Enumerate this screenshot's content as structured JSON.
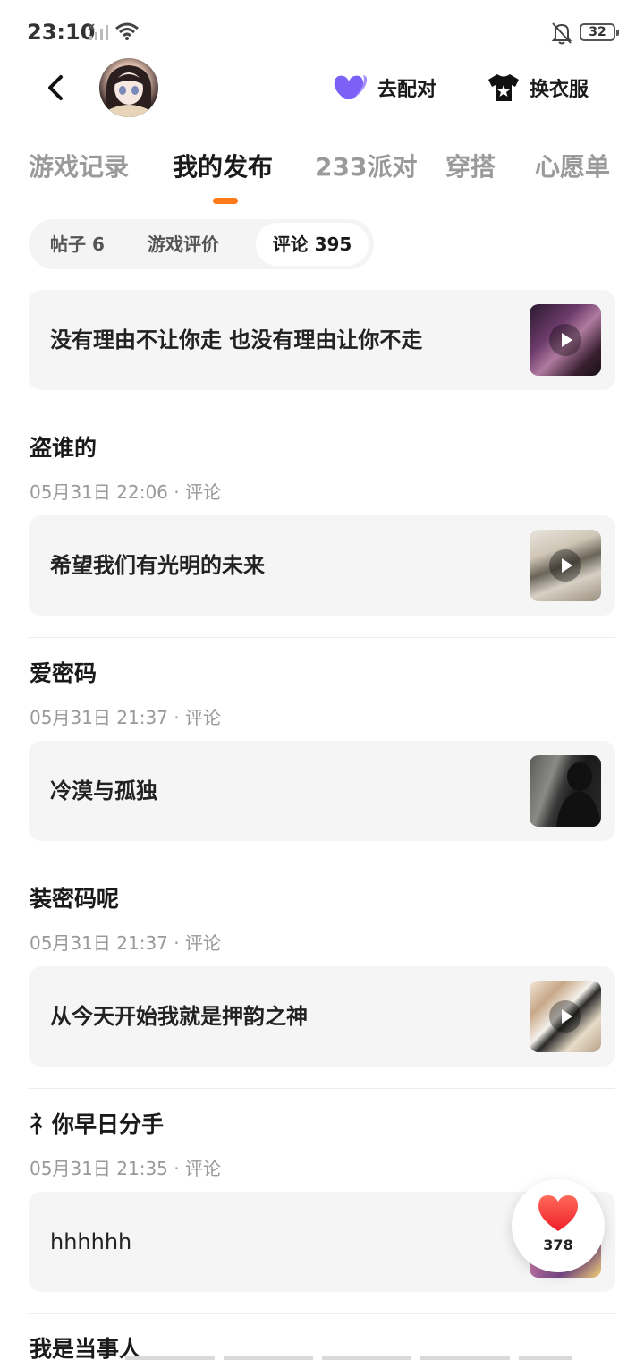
{
  "status_bar": {
    "time": "23:10",
    "battery": "32"
  },
  "header": {
    "pair_label": "去配对",
    "outfit_label": "换衣服",
    "pair_color": "#7b61f5"
  },
  "main_tabs": [
    {
      "label": "游戏记录",
      "active": false
    },
    {
      "label": "我的发布",
      "active": true
    },
    {
      "label": "233派对",
      "active": false
    },
    {
      "label": "穿搭",
      "active": false
    },
    {
      "label": "心愿单",
      "active": false
    }
  ],
  "sub_tabs": [
    {
      "label": "帖子 6",
      "active": false
    },
    {
      "label": "游戏评价",
      "active": false
    },
    {
      "label": "评论 395",
      "active": true
    }
  ],
  "feed": {
    "first_card": {
      "text": "没有理由不让你走 也没有理由让你不走",
      "has_video": true
    },
    "items": [
      {
        "title": "盗谁的",
        "meta": "05月31日 22:06 · 评论",
        "card_text": "希望我们有光明的未来",
        "has_video": true
      },
      {
        "title": "爱密码",
        "meta": "05月31日 21:37 · 评论",
        "card_text": "冷漠与孤独",
        "has_video": false
      },
      {
        "title": "装密码呢",
        "meta": "05月31日 21:37 · 评论",
        "card_text": "从今天开始我就是押韵之神",
        "has_video": true
      },
      {
        "title": "礻你早日分手",
        "meta": "05月31日 21:35 · 评论",
        "card_text": "hhhhhh",
        "has_video": false
      },
      {
        "title": "我是当事人"
      }
    ]
  },
  "like_button": {
    "count": "378",
    "color": "#ff3b3b"
  },
  "accent_color": "#ff7a1a"
}
